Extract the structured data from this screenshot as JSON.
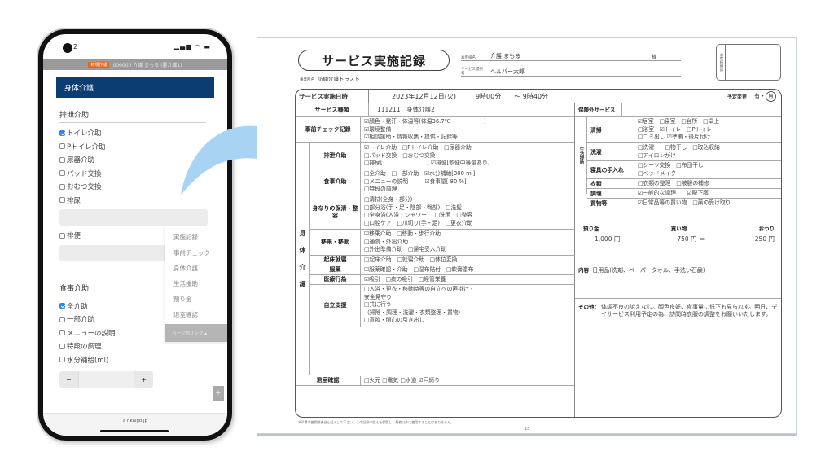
{
  "phone": {
    "status_bar": {
      "time": "2",
      "icons": "signal wifi battery"
    },
    "user_bar": {
      "badge": "新規作成",
      "user": "000000 介護 まもる (要介護1)"
    },
    "page_header": "身体介護",
    "sections": [
      {
        "title": "排泄介助",
        "items": [
          {
            "label": "トイレ介助",
            "checked": true
          },
          {
            "label": "Pトイレ介助",
            "checked": false
          },
          {
            "label": "尿器介助",
            "checked": false
          },
          {
            "label": "パッド交換",
            "checked": false
          },
          {
            "label": "おむつ交換",
            "checked": false
          },
          {
            "label": "排尿",
            "checked": false
          },
          {
            "label": "排便",
            "checked": false
          }
        ]
      },
      {
        "title": "食事介助",
        "items": [
          {
            "label": "全介助",
            "checked": true
          },
          {
            "label": "一部介助",
            "checked": false
          },
          {
            "label": "メニューの説明",
            "checked": false
          },
          {
            "label": "特段の調理",
            "checked": false
          },
          {
            "label": "水分補給(ml)",
            "checked": false
          }
        ]
      }
    ],
    "stepper": {
      "minus": "−",
      "plus": "+",
      "value": ""
    },
    "page_menu": {
      "items": [
        "実施記録",
        "事前チェック",
        "身体介護",
        "生活援助",
        "預り金",
        "退室確認"
      ],
      "button": "ページ内リンク ▴"
    },
    "add_button": "+",
    "url": "a  hkaigo.jp"
  },
  "document": {
    "title": "サービス実施記録",
    "office": {
      "label": "事業所名",
      "value": "訪問介護トラスト"
    },
    "client": {
      "label": "お客様名",
      "value": "介護 まもる",
      "suffix": "様"
    },
    "staff": {
      "label": "サービス提供者",
      "value": "ヘルパー太郎"
    },
    "stamp": {
      "label": "お客様確認"
    },
    "datetime": {
      "label": "サービス実施日時",
      "date": "2023年12月12日(火)",
      "start": "9時00分",
      "end": "〜 9時40分"
    },
    "schedule_change": {
      "label": "予定変更",
      "value": "有・",
      "selected": "無"
    },
    "service_type": {
      "label": "サービス種類",
      "value": "111211：身体介護2"
    },
    "insurance_ext": {
      "label": "保険外サービス"
    },
    "body_care_label": [
      "身",
      "体",
      "介",
      "護"
    ],
    "left_rows": [
      {
        "key": "事前チェック記録",
        "lines": [
          "☑顔色・発汗・体温等(体温36.7℃　　　　　　)",
          "☑環境整備",
          "☑相談援助・情報収集・提供・記録等"
        ]
      },
      {
        "key": "排泄介助",
        "lines": [
          "☑トイレ介助　□Pトイレ介助　□尿器介助",
          "□パッド交換　□おむつ交換",
          "□排尿[　　　　　　　　] ☑排便[軟便中等量あり]"
        ]
      },
      {
        "key": "食事介助",
        "lines": [
          "□全介助　□一部介助　☑水分補給[300 ml]",
          "□メニューの説明　　　☑食事量[ 80 %]",
          "□特段の調理"
        ]
      },
      {
        "key": "身なりの保清・整容",
        "lines": [
          "□清拭(全身・部分)",
          "□部分浴(手・足・陰部・臀部)　□洗髪",
          "□全身浴(入浴・シャワー)　□洗面　□整容",
          "□口腔ケア　□爪切り(手・足)　□更衣介助"
        ]
      },
      {
        "key": "移乗・移動",
        "lines": [
          "☑移乗介助　□移動・歩行介助",
          "□通院・外出介助",
          "□外出準備介助　□帰宅受入介助"
        ]
      },
      {
        "key": "起床就寝",
        "lines": [
          "□起床介助　□就寝介助　□体位変換"
        ]
      },
      {
        "key": "服薬",
        "lines": [
          "☑服薬確認・介助　□湿布貼付　□軟膏塗布"
        ]
      },
      {
        "key": "医療行為",
        "lines": [
          "☑吸引　□痰の吸引　□経管栄養"
        ]
      },
      {
        "key": "自立支援",
        "lines": [
          "□入浴・更衣・移動時等の自立への声掛け・",
          "安全見守り",
          "□共に行う",
          "（掃除・調理・洗濯・衣類整理・買物）",
          "□意欲・関心の引き出し"
        ]
      },
      {
        "key": "退室確認",
        "lines": [
          "□火元 □電気 □水道 ☑戸締り"
        ]
      }
    ],
    "life_support_label": "生活援助",
    "right_rows": [
      {
        "key": "清掃",
        "lines": [
          "☑居室　□寝室　□台所　□卓上",
          "□浴室　☑トイレ　□Pトイレ",
          "□ゴミ出し ☑準備・後片付け"
        ]
      },
      {
        "key": "洗濯",
        "lines": [
          "□洗濯　　□物干し　□取込収納",
          "□アイロンがけ"
        ]
      },
      {
        "key": "寝具の手入れ",
        "lines": [
          "□シーツ交換　□布団干し",
          "□ベッドメイク"
        ]
      },
      {
        "key": "衣類",
        "lines": [
          "□衣類の整理　□被服の補修"
        ]
      },
      {
        "key": "調理",
        "lines": [
          "☑一般的な調理　　☑配下膳"
        ]
      },
      {
        "key": "買物等",
        "lines": [
          "☑日常品等の買い物　□薬の受け取り"
        ]
      }
    ],
    "money": {
      "labels": [
        "預り金",
        "買い物",
        "おつり"
      ],
      "values": [
        "1,000 円 −",
        "750 円 ＝",
        "250 円"
      ]
    },
    "contents": {
      "label": "内容",
      "value": "日用品(洗剤、ペーパータオル、手洗い石鹸)"
    },
    "other": {
      "label": "その他：",
      "value": "体調不良の訴えなし。顔色良好、食事量に低下も見られず。明日、デイサービス利用予定の為、訪問時衣服の調整をお願いいたします。"
    },
    "footnote": "※印欄は被保険者自ら記入して下さい。この記録の控えを保管し、業務以外に使用することはありません。",
    "page_number": "15"
  }
}
